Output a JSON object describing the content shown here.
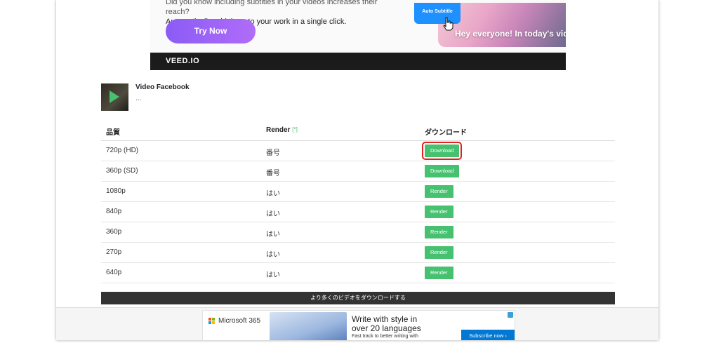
{
  "banner": {
    "copy_line1": "Did you know including subtitles in your videos increases their reach?",
    "copy_line2": "Automatically add them to your work in a single click.",
    "cta_label": "Try Now",
    "auto_subtitle_label": "Auto Subtitle",
    "caption": "Hey everyone! In today's vid",
    "brand": "VEED.IO"
  },
  "video": {
    "title": "Video Facebook",
    "subtitle": "..."
  },
  "table": {
    "headers": {
      "quality": "品質",
      "render": "Render",
      "render_note": "[*]",
      "download": "ダウンロード"
    },
    "rows": [
      {
        "quality": "720p (HD)",
        "render": "番号",
        "action": "Download",
        "highlighted": true
      },
      {
        "quality": "360p (SD)",
        "render": "番号",
        "action": "Download",
        "highlighted": false
      },
      {
        "quality": "1080p",
        "render": "はい",
        "action": "Render",
        "highlighted": false
      },
      {
        "quality": "840p",
        "render": "はい",
        "action": "Render",
        "highlighted": false
      },
      {
        "quality": "360p",
        "render": "はい",
        "action": "Render",
        "highlighted": false
      },
      {
        "quality": "270p",
        "render": "はい",
        "action": "Render",
        "highlighted": false
      },
      {
        "quality": "640p",
        "render": "はい",
        "action": "Render",
        "highlighted": false
      }
    ]
  },
  "more_button_label": "より多くのビデオをダウンロードする",
  "bottom_ad": {
    "brand": "Microsoft 365",
    "headline_line1": "Write with style in",
    "headline_line2": "over 20 languages",
    "small_text": "Fast track to better writing with",
    "cta": "Subscribe now ›"
  },
  "colors": {
    "accent_green": "#46c16f",
    "highlight_red": "#e02020",
    "purple_cta": "#8a5cf6",
    "ms_blue": "#0078d4"
  }
}
